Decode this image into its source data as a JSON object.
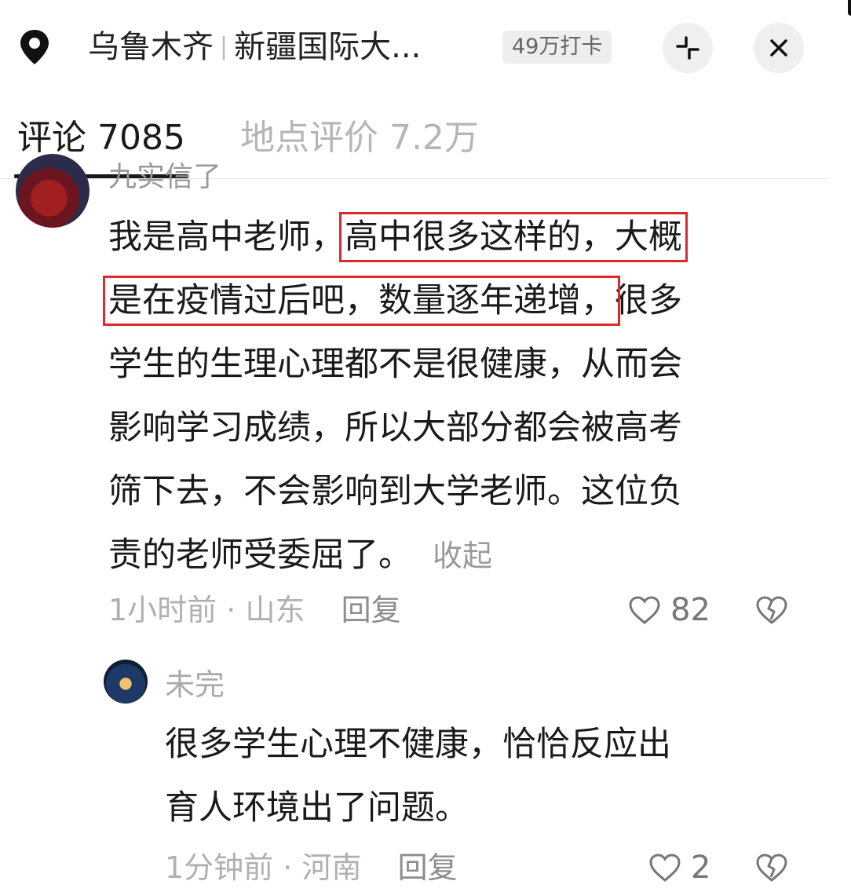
{
  "header": {
    "location_city": "乌鲁木齐",
    "location_separator": "|",
    "location_place": "新疆国际大...",
    "checkin_badge": "49万打卡"
  },
  "tabs": [
    {
      "label": "评论 7085",
      "active": true
    },
    {
      "label": "地点评价 7.2万",
      "active": false
    }
  ],
  "comment": {
    "username_partial": "九实信了",
    "lines": [
      {
        "pre": "我是高中老师，",
        "hl": "高中很多这样的，大概",
        "post": ""
      },
      {
        "pre": "",
        "hl": "是在疫情过后吧，数量逐年递增，",
        "post": "很多"
      },
      {
        "pre": "学生的生理心理都不是很健康，从而会",
        "hl": "",
        "post": ""
      },
      {
        "pre": "影响学习成绩，所以大部分都会被高考",
        "hl": "",
        "post": ""
      },
      {
        "pre": "筛下去，不会影响到大学老师。这位负",
        "hl": "",
        "post": ""
      },
      {
        "pre": "责的老师受委屈了。",
        "hl": "",
        "post": ""
      }
    ],
    "collapse_label": "收起",
    "time": "1小时前",
    "dot": "·",
    "region": "山东",
    "reply_label": "回复",
    "likes": "82"
  },
  "reply": {
    "username": "未完",
    "lines": [
      "很多学生心理不健康，恰恰反应出",
      "育人环境出了问题。"
    ],
    "time": "1分钟前",
    "dot": "·",
    "region": "河南",
    "reply_label": "回复",
    "likes": "2"
  },
  "colors": {
    "highlight_box": "#d92b2b",
    "active_tab": "#1a1a1a",
    "inactive_tab": "#b5b5b5"
  },
  "icons": [
    "location-pin-icon",
    "collapse-icon",
    "close-icon",
    "heart-icon",
    "dislike-heart-icon"
  ]
}
